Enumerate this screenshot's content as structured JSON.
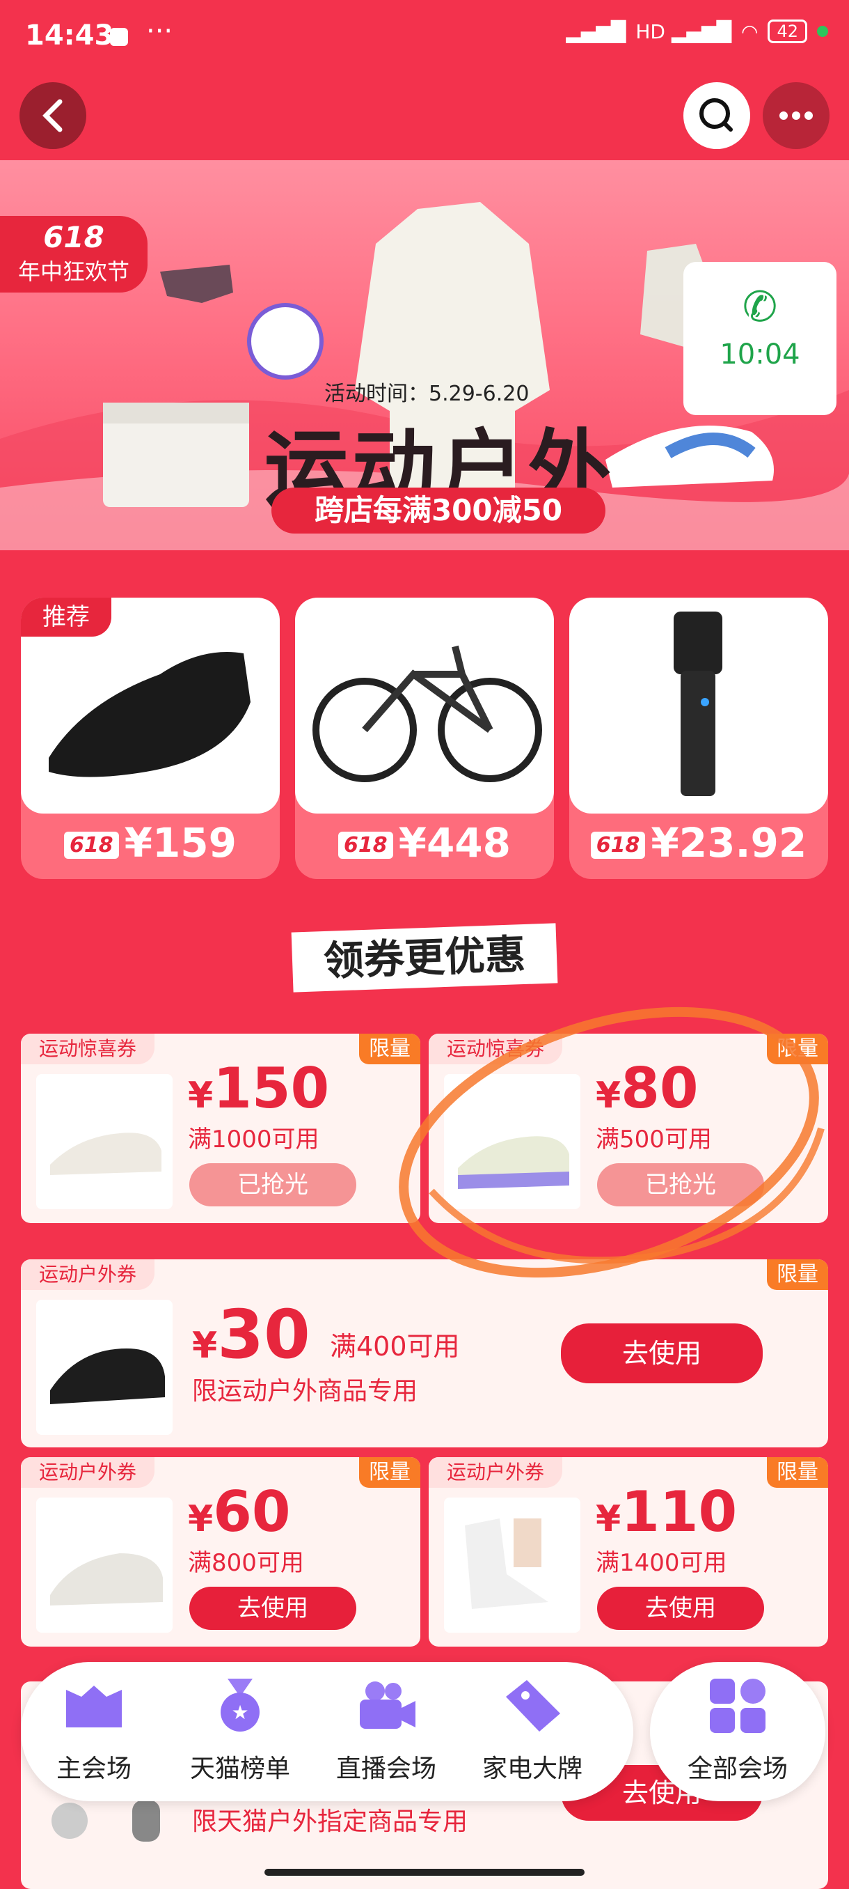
{
  "status_bar": {
    "time": "14:43",
    "dots": "···",
    "signal": "HD",
    "battery": "42"
  },
  "banner": {
    "badge_number": "618",
    "badge_text": "年中狂欢节",
    "activity_time": "活动时间：5.29-6.20",
    "title": "运动户外",
    "subtitle": "跨店每满300减50",
    "call_time": "10:04"
  },
  "products": [
    {
      "tag": "618",
      "price": "¥159"
    },
    {
      "tag": "618",
      "price": "¥448"
    },
    {
      "tag": "618",
      "price": "¥23.92"
    }
  ],
  "recommend_label": "推荐",
  "section_title": "领券更优惠",
  "coupons": [
    {
      "label": "运动惊喜券",
      "limit": "限量",
      "amount": "150",
      "currency": "¥",
      "condition": "满1000可用",
      "button": "已抢光"
    },
    {
      "label": "运动惊喜券",
      "limit": "限量",
      "amount": "80",
      "currency": "¥",
      "condition": "满500可用",
      "button": "已抢光"
    },
    {
      "label": "运动户外券",
      "limit": "限量",
      "amount": "30",
      "currency": "¥",
      "condition": "满400可用",
      "note": "限运动户外商品专用",
      "button": "去使用"
    },
    {
      "label": "运动户外券",
      "limit": "限量",
      "amount": "60",
      "currency": "¥",
      "condition": "满800可用",
      "button": "去使用"
    },
    {
      "label": "运动户外券",
      "limit": "限量",
      "amount": "110",
      "currency": "¥",
      "condition": "满1400可用",
      "button": "去使用"
    }
  ],
  "partial_coupon": {
    "note": "限天猫户外指定商品专用",
    "button": "去使用"
  },
  "nav": {
    "items": [
      {
        "label": "主会场",
        "icon": "main-venue-icon"
      },
      {
        "label": "天猫榜单",
        "icon": "medal-icon"
      },
      {
        "label": "直播会场",
        "icon": "live-camera-icon"
      },
      {
        "label": "家电大牌",
        "icon": "tag-icon"
      }
    ],
    "all_label": "全部会场",
    "all_icon": "grid-icon"
  }
}
